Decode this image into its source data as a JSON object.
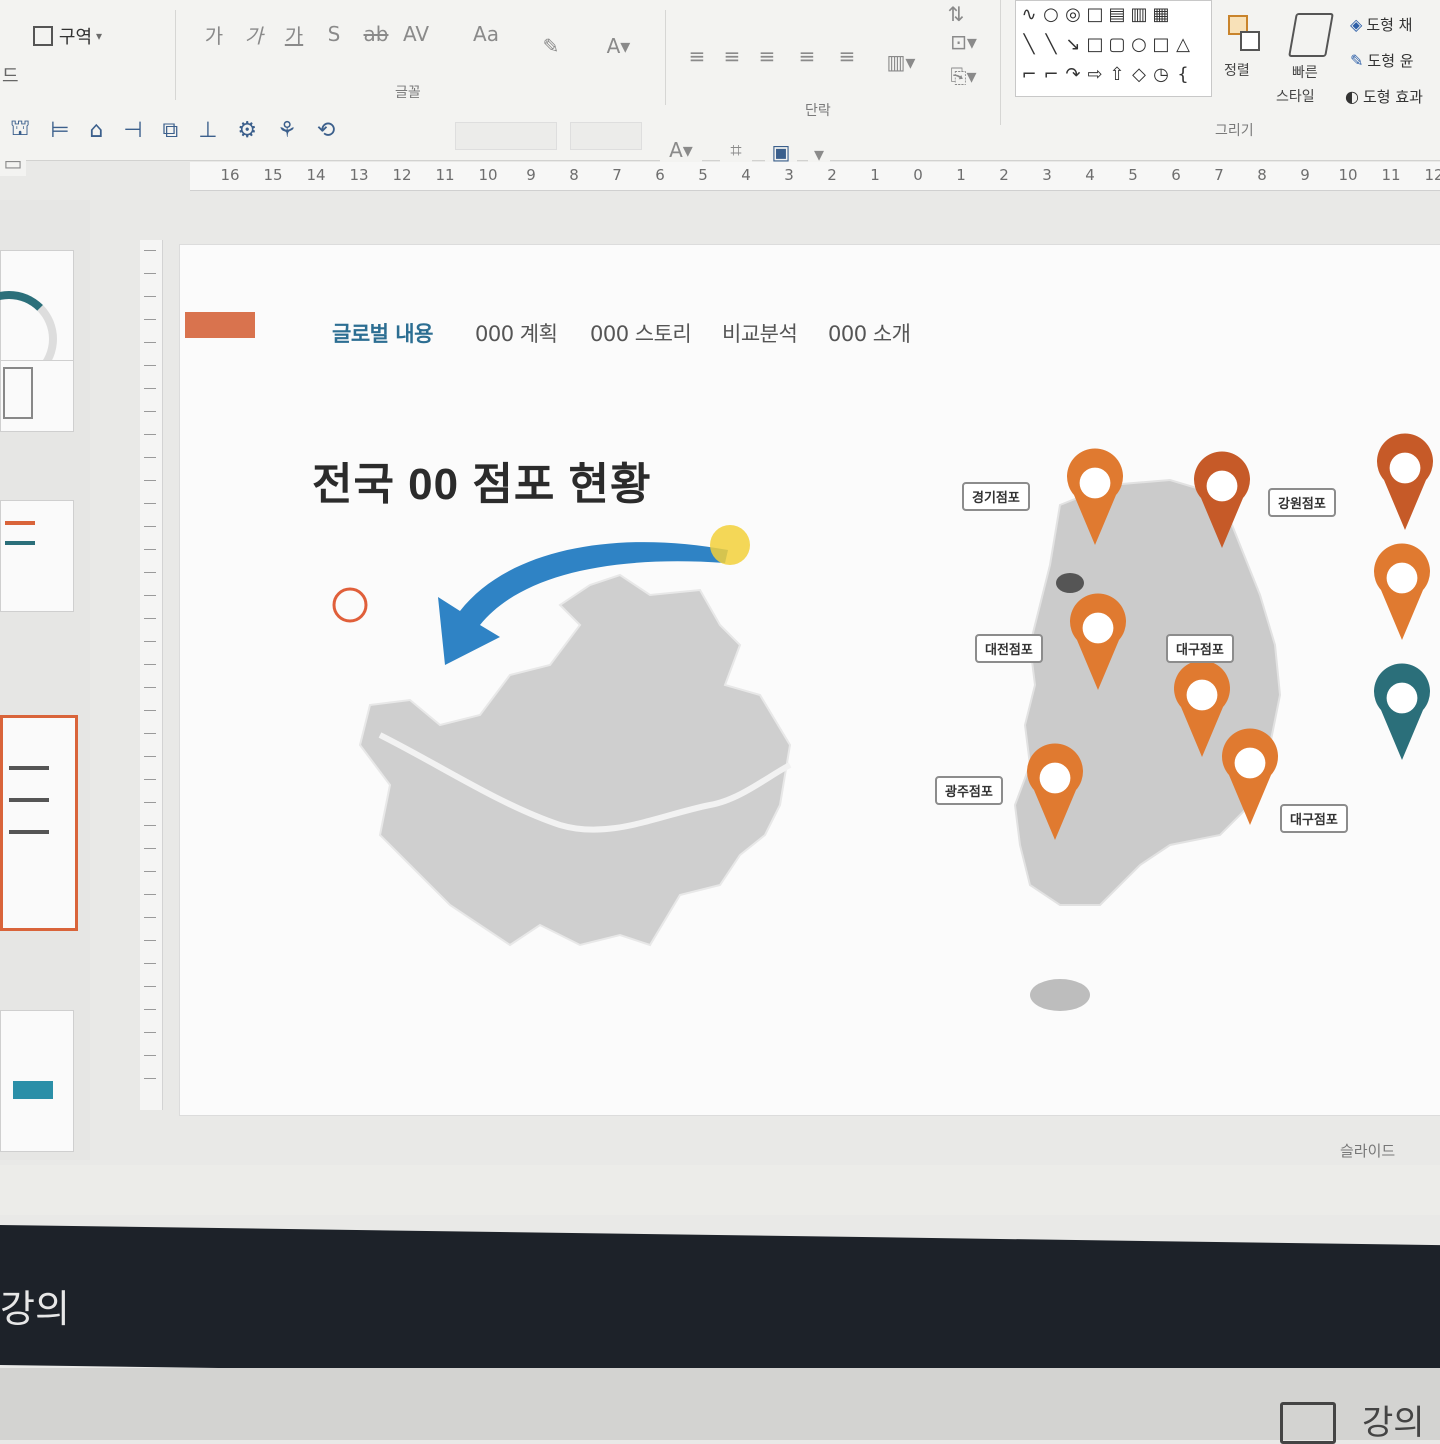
{
  "ribbon": {
    "section_label": "구역",
    "section_chevron": "▾",
    "home_letter": "드",
    "font_group_label": "글꼴",
    "paragraph_group_label": "단락",
    "drawing_group_label": "그리기",
    "arrange_label": "정렬",
    "quick_style_label": "빠른",
    "quick_style_sub": "스타일",
    "shape_fill_label": "도형 채",
    "shape_outline_label": "도형 윤",
    "shape_effect_label": "도형 효과"
  },
  "ruler": {
    "ticks": [
      "16",
      "15",
      "14",
      "13",
      "12",
      "11",
      "10",
      "9",
      "8",
      "7",
      "6",
      "5",
      "4",
      "3",
      "2",
      "1",
      "0",
      "1",
      "2",
      "3",
      "4",
      "5",
      "6",
      "7",
      "8",
      "9",
      "10",
      "11",
      "12"
    ]
  },
  "slide": {
    "nav": [
      "글로벌 내용",
      "000 계획",
      "000 스토리",
      "비교분석",
      "000 소개"
    ],
    "title": "전국 00 점포 현황",
    "regions": [
      {
        "name": "경기점포"
      },
      {
        "name": "강원점포"
      },
      {
        "name": "대전점포"
      },
      {
        "name": "대구점포"
      },
      {
        "name": "광주점포"
      },
      {
        "name": "대구점포"
      }
    ]
  },
  "status": {
    "right_label": "슬라이드"
  },
  "taskbar": {
    "text": "강의"
  },
  "corner": {
    "text": "강의"
  },
  "colors": {
    "accent_orange": "#e07a30",
    "accent_orange_dark": "#c65a28",
    "pin_teal": "#2b6f7a",
    "arrow_blue": "#2f83c5",
    "map_gray": "#c9c9c9"
  }
}
